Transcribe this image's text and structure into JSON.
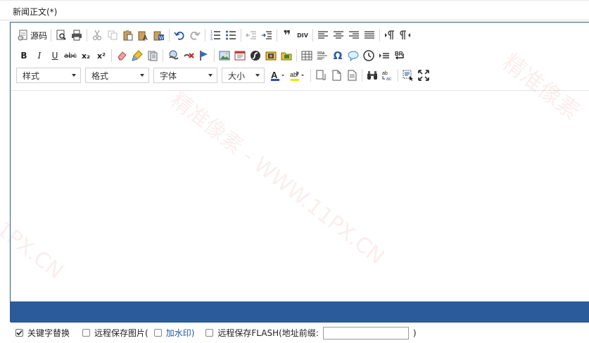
{
  "field": {
    "label": "新闻正文(*)"
  },
  "toolbar": {
    "source_label": "源码",
    "combos": {
      "style": "样式",
      "format": "格式",
      "font": "字体",
      "size": "大小"
    },
    "icons": {
      "blockquote": "❞",
      "div": "DIV",
      "bold": "B",
      "italic": "I",
      "underline": "U",
      "strike": "abc",
      "subscript": "x₂",
      "superscript": "x²",
      "special_char": "Ω",
      "page_break": "BR",
      "spell_check": "abc"
    },
    "accent_colors": {
      "font_color": "#2a4fa8",
      "bg_color": "#f5e200"
    }
  },
  "options": {
    "keyword_replace": {
      "label": "关键字替换",
      "checked": true
    },
    "remote_images": {
      "label": "远程保存图片(",
      "checked": false
    },
    "watermark": {
      "label": "加水印)",
      "checked": false
    },
    "remote_flash": {
      "label": "远程保存FLASH(地址前缀:",
      "checked": false
    },
    "remote_flash_close": ")",
    "prefix_value": ""
  },
  "watermark": {
    "line1": "精准像素 - WWW.11PX.CN",
    "line2": "精准像素",
    "line3": "11PX.CN"
  },
  "colors": {
    "editor_border": "#2a5a98",
    "statusbar": "#2b5b9b"
  }
}
